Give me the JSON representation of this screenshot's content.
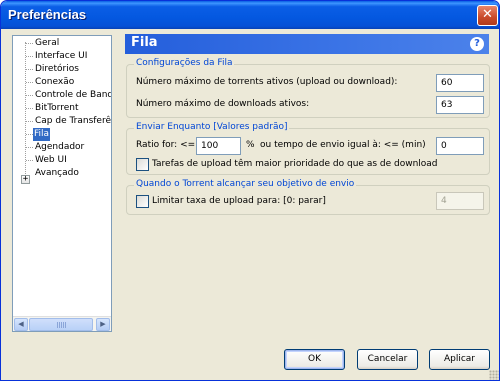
{
  "window": {
    "title": "Preferências",
    "close_glyph": "✕"
  },
  "sidebar": {
    "items": [
      {
        "label": "Geral"
      },
      {
        "label": "Interface UI"
      },
      {
        "label": "Diretórios"
      },
      {
        "label": "Conexão"
      },
      {
        "label": "Controle de Banda"
      },
      {
        "label": "BitTorrent"
      },
      {
        "label": "Cap de Transferência"
      },
      {
        "label": "Fila",
        "selected": true
      },
      {
        "label": "Agendador"
      },
      {
        "label": "Web UI"
      },
      {
        "label": "Avançado",
        "expandable": true
      }
    ],
    "expander_glyph": "+",
    "scroll_left": "◀",
    "scroll_right": "▶"
  },
  "panel": {
    "title": "Fila",
    "help_glyph": "?"
  },
  "queue_settings": {
    "title": "Configurações da Fila",
    "max_active_label": "Número máximo de torrents ativos (upload ou download):",
    "max_active_value": "60",
    "max_downloads_label": "Número máximo de downloads ativos:",
    "max_downloads_value": "63"
  },
  "seeding": {
    "title": "Enviar Enquanto [Valores padrão]",
    "ratio_label": "Ratio for: <=",
    "ratio_value": "100",
    "percent_label": "%",
    "time_label": "ou tempo de envio igual à: <= (min)",
    "time_value": "0",
    "priority_label": "Tarefas de upload têm maior prioridade do que as de download",
    "priority_checked": false
  },
  "goal": {
    "title": "Quando o Torrent alcançar seu objetivo de envio",
    "limit_label": "Limitar taxa de upload para: [0: parar]",
    "limit_checked": false,
    "limit_value": "4"
  },
  "buttons": {
    "ok": "OK",
    "cancel": "Cancelar",
    "apply": "Aplicar"
  },
  "colors": {
    "titlebar": "#0458e0",
    "header": "#245edb",
    "selection": "#316ac5",
    "group_title": "#0046d5"
  }
}
